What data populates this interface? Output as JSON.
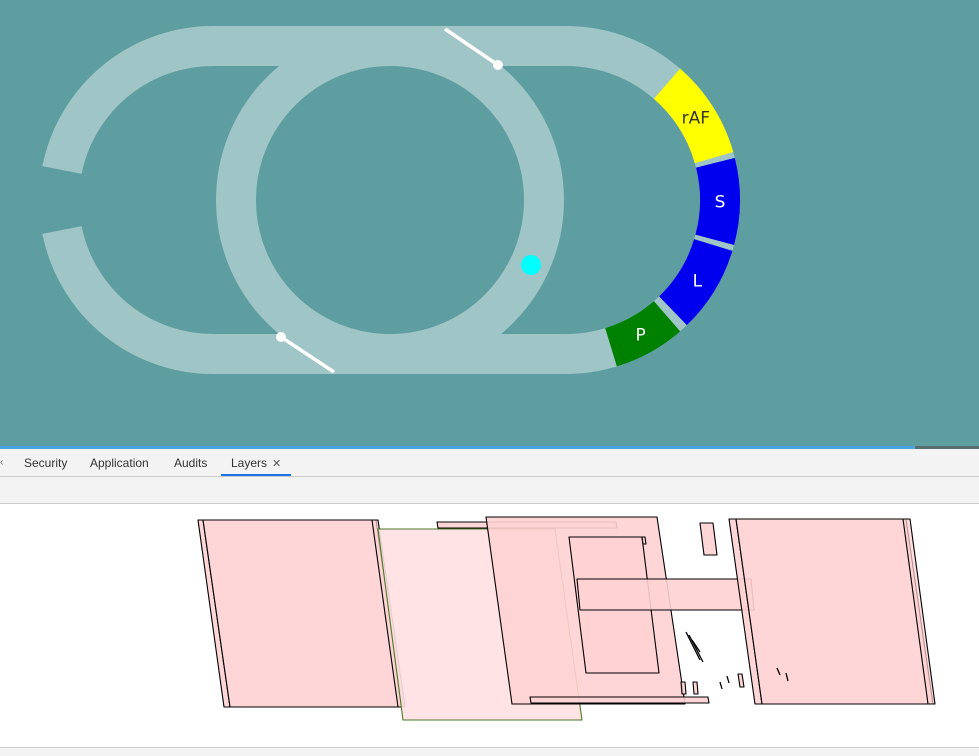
{
  "viewport": {
    "background": "#5f9ea0",
    "track_color": "#9fc5c6",
    "marker_color": "#00ffff",
    "pipeline": [
      {
        "label": "rAF",
        "color": "#ffff00",
        "text_color": "#333333"
      },
      {
        "label": "S",
        "color": "#0000ee",
        "text_color": "#ffffff"
      },
      {
        "label": "L",
        "color": "#0000ee",
        "text_color": "#ffffff"
      },
      {
        "label": "P",
        "color": "#008000",
        "text_color": "#ffffff"
      }
    ]
  },
  "loading_progress": 0.935,
  "devtools": {
    "tabs": [
      {
        "label": "Security",
        "active": false
      },
      {
        "label": "Application",
        "active": false
      },
      {
        "label": "Audits",
        "active": false
      },
      {
        "label": "Layers",
        "active": true,
        "close": "✕"
      }
    ],
    "overflow_icon": "chevron-left-icon"
  },
  "layers_view": {
    "layer_fill": "#ffd1d3",
    "layer_stroke": "#000000"
  }
}
